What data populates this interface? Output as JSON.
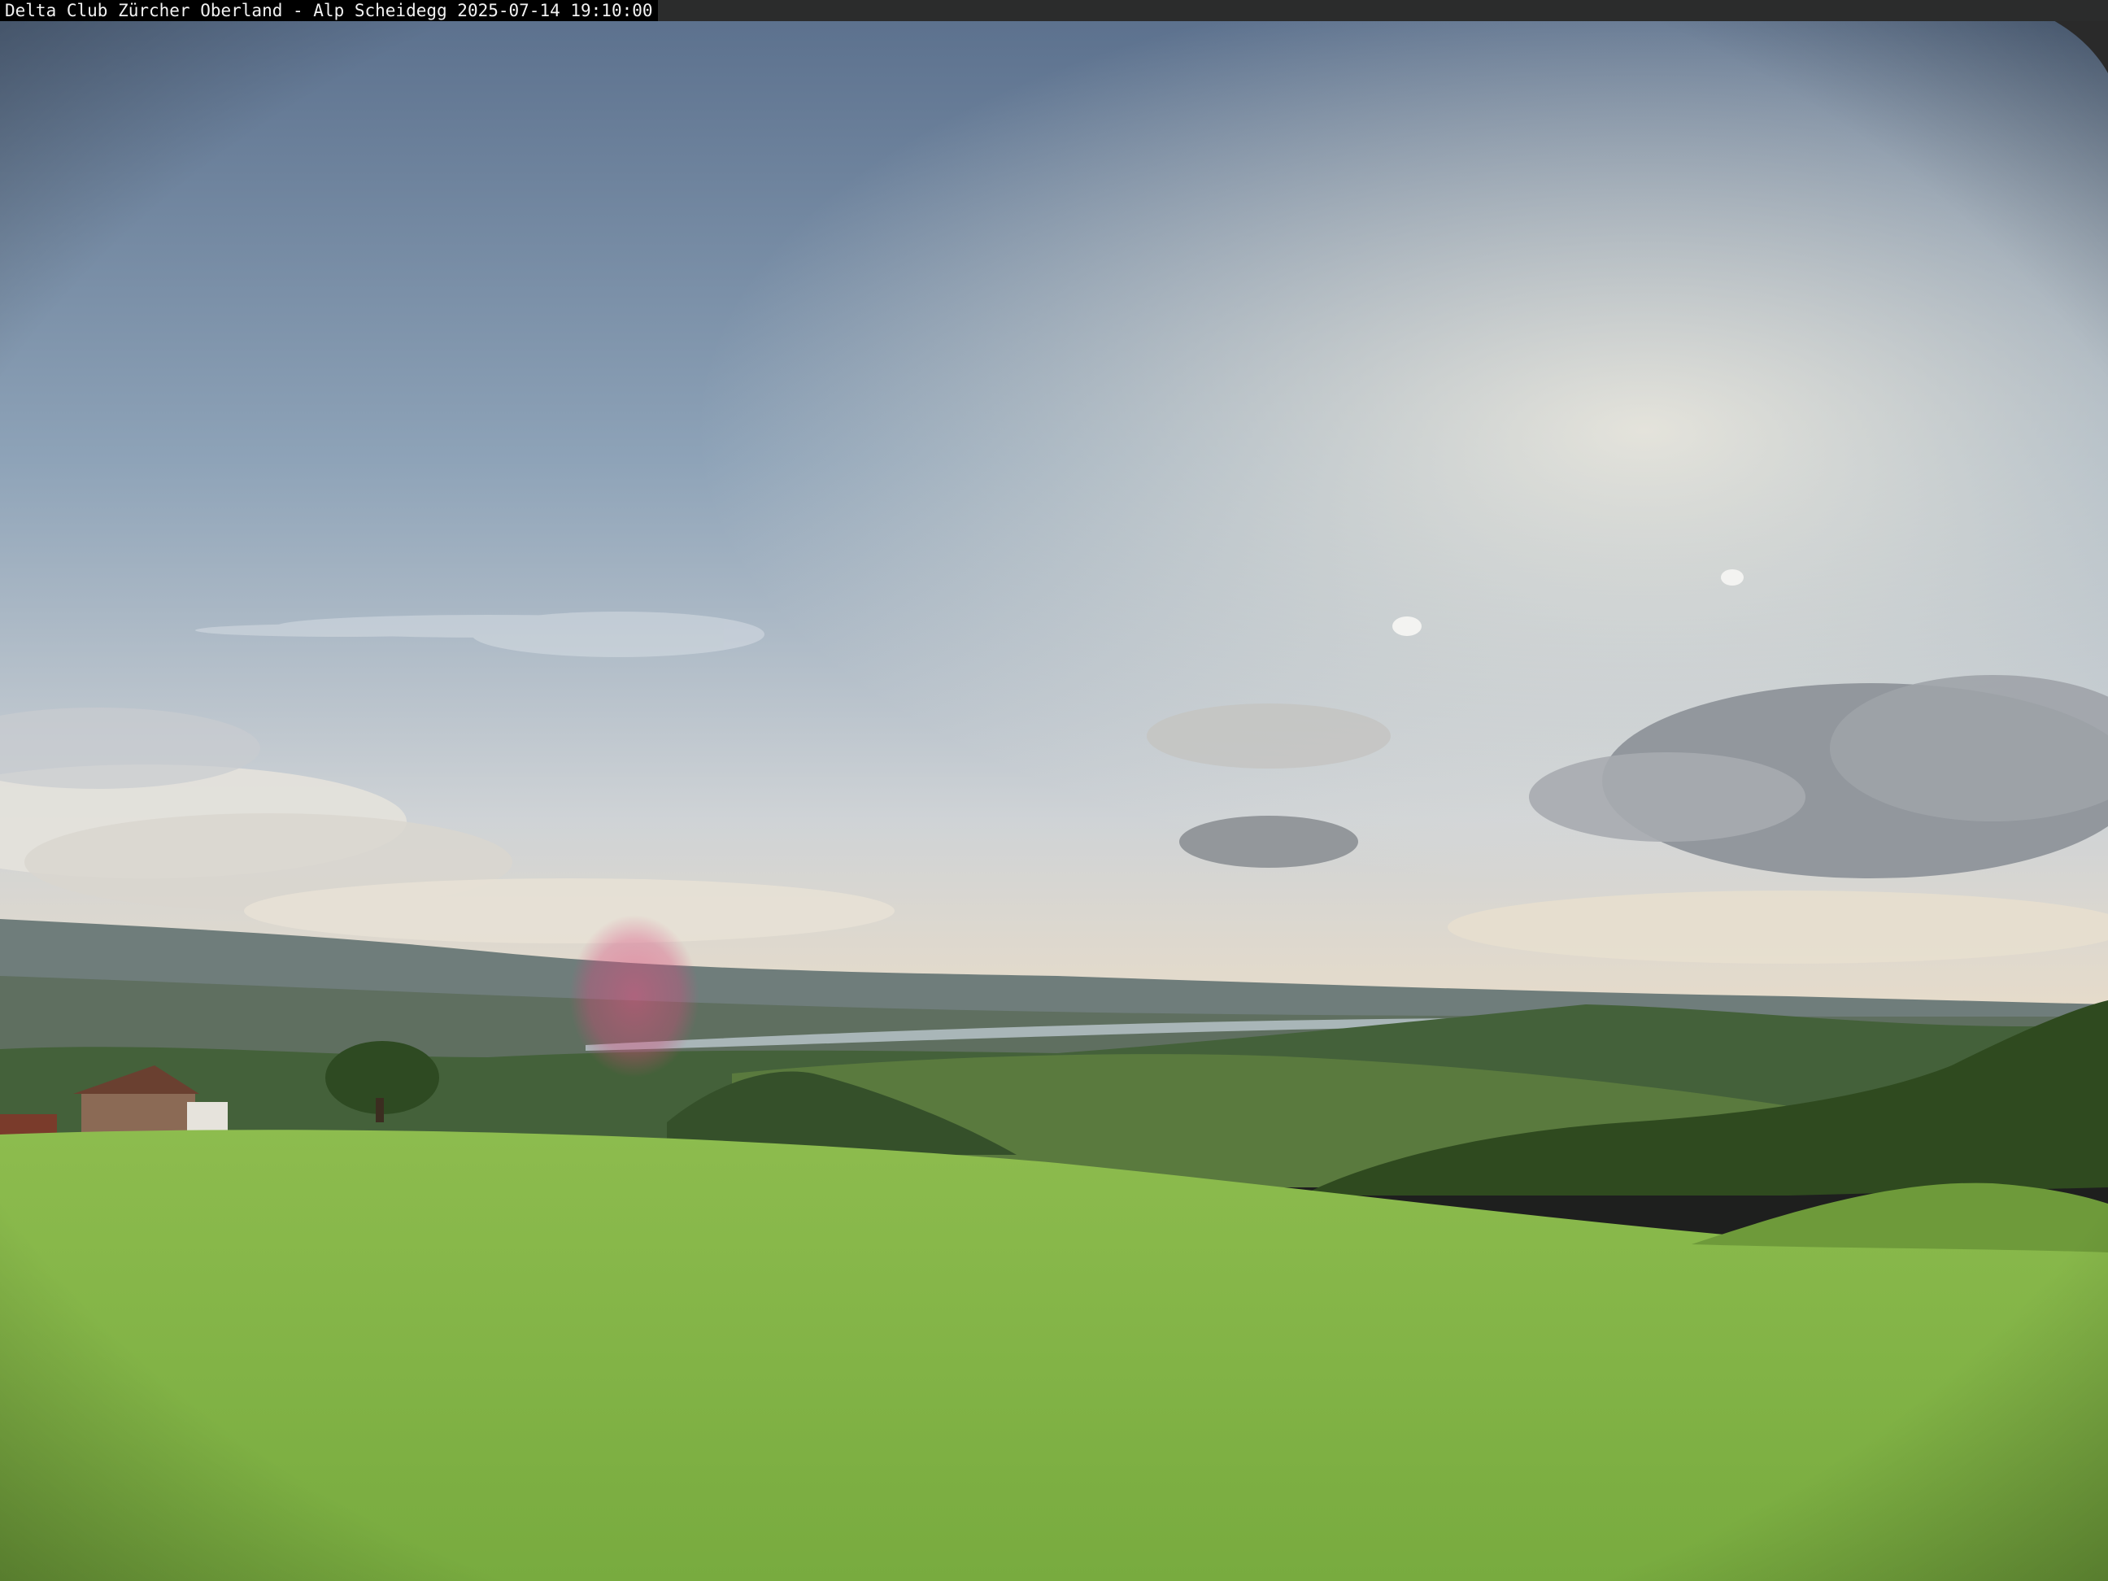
{
  "overlay": {
    "caption": "Delta Club Zürcher Oberland - Alp Scheidegg 2025-07-14 19:10:00"
  },
  "colors": {
    "sky_top": "#5d7390",
    "sky_mid": "#8fa4b9",
    "sky_horizon": "#e6dccb",
    "distant_hills": "#6b7a78",
    "lake": "#a9b6b8",
    "forest": "#314a22",
    "meadow_near": "#7fb345",
    "meadow_far": "#8cbb4c",
    "caption_bg": "#000000",
    "caption_text": "#f2f2f2",
    "lens_flare": "#d9487c"
  }
}
